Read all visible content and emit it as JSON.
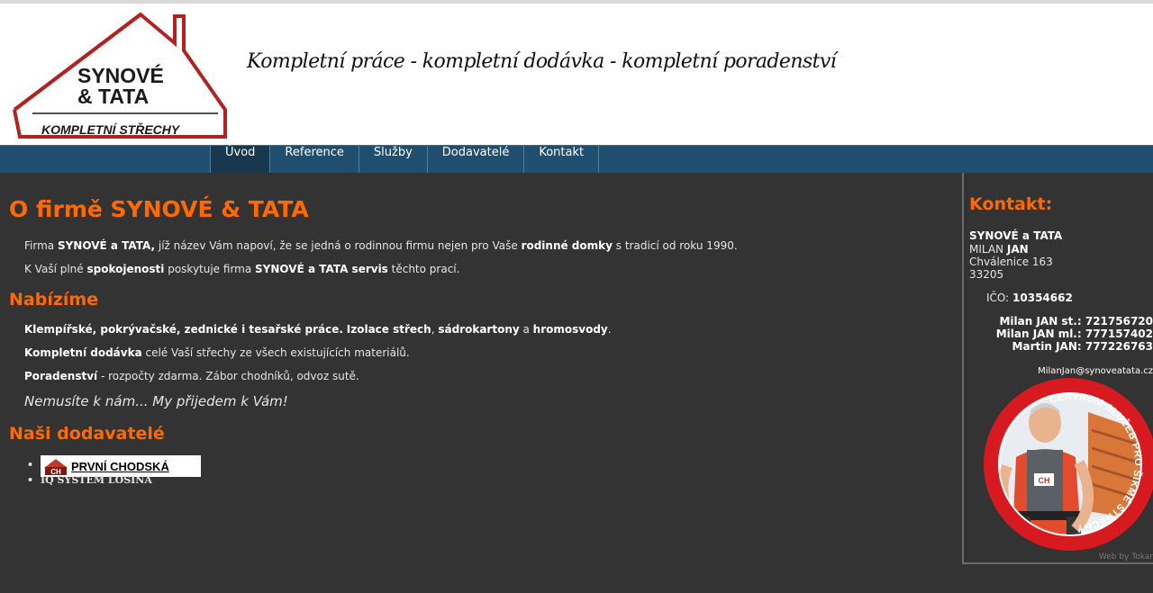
{
  "header": {
    "logo": {
      "line1": "SYNOVÉ",
      "line2": "& TATA",
      "line3": "KOMPLETNÍ STŘECHY",
      "color": "#b22222"
    },
    "slogan": "Kompletní práce - kompletní dodávka - kompletní poradenství"
  },
  "nav": {
    "items": [
      {
        "label": "Úvod",
        "active": true
      },
      {
        "label": "Reference"
      },
      {
        "label": "Služby"
      },
      {
        "label": "Dodavatelé"
      },
      {
        "label": "Kontakt"
      }
    ]
  },
  "main": {
    "title": "O firmě SYNOVÉ & TATA",
    "intro1": {
      "t1": "Firma ",
      "b1": "SYNOVÉ a TATA,",
      "t2": " jíž název Vám napoví, že se jedná o rodinnou firmu nejen pro Vaše ",
      "b2": "rodinné domky",
      "t3": " s tradicí od roku 1990."
    },
    "intro2": {
      "t1": "K Vaší plné ",
      "b1": "spokojenosti",
      "t2": " poskytuje firma ",
      "b2": "SYNOVÉ a TATA servis",
      "t3": " těchto prací."
    },
    "offer_title": "Nabízíme",
    "offer1": {
      "b1": "Klempířské, pokrývačské, zednické i tesařské práce.",
      "t1": " ",
      "b2": "Izolace střech",
      "t2": ", ",
      "b3": "sádrokartony",
      "t3": " a ",
      "b4": "hromosvody",
      "t4": "."
    },
    "offer2": {
      "b1": "Kompletní dodávka",
      "t1": " celé Vaší střechy ze všech existujících materiálů."
    },
    "offer3": {
      "b1": "Poradenství",
      "t1": " - rozpočty zdarma. Zábor chodníků, odvoz sutě."
    },
    "slogan": "Nemusíte k nám... My přijedem k Vám!",
    "suppliers_title": "Naši dodavatelé",
    "suppliers": [
      {
        "label": "PRVNÍ CHODSKÁ",
        "logo_mark": "CH"
      },
      {
        "label": "IQ SYSTÉM LOSINÁ"
      }
    ]
  },
  "sidebar": {
    "title": "Kontakt:",
    "company": "SYNOVÉ a TATA",
    "name_first": "MILAN ",
    "name_last": "JAN",
    "street": "Chválenice 163",
    "zip": "33205",
    "ico_label": "IČO: ",
    "ico_value": "10354662",
    "phones": [
      "Milan JAN st.: 721756720",
      "Milan JAN ml.: 777157402",
      "Martin JAN: 777226763"
    ],
    "email": "MilanJan@synoveatata.cz",
    "badge_text": "CENTRUM SLUŽEB PRO ŠIKMÉ STŘECHY",
    "badge_mark": "CH",
    "credit": "Web by Tokar"
  },
  "colors": {
    "accent": "#ff6a00",
    "nav_bg": "#1f4e6e",
    "nav_active": "#18384f",
    "body_bg": "#333333",
    "logo_red": "#b22222"
  }
}
